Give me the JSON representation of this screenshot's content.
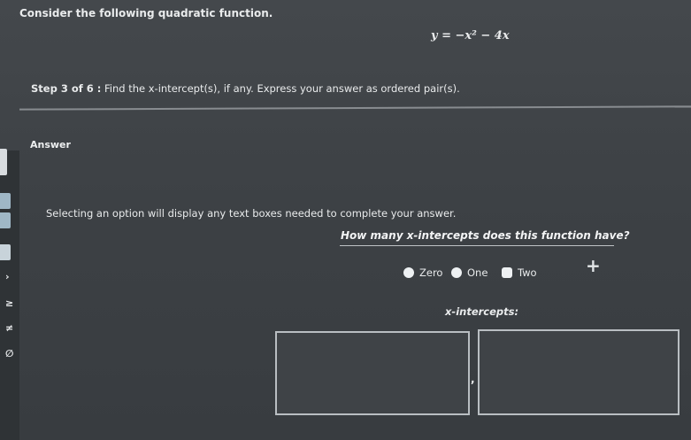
{
  "question": {
    "intro": "Consider the following quadratic function.",
    "equation": "y = −x² − 4x"
  },
  "step": {
    "label": "Step 3 of 6 :",
    "instruction": "Find the x-intercept(s), if any. Express your answer as ordered pair(s)."
  },
  "answer": {
    "heading": "Answer",
    "instruction": "Selecting an option will display any text boxes needed to complete your answer.",
    "prompt": "How many x-intercepts does this function have?",
    "options": [
      {
        "label": "Zero"
      },
      {
        "label": "One"
      },
      {
        "label": "Two"
      }
    ],
    "intercepts_label": "x-intercepts:",
    "separator": ",",
    "add_symbol": "+"
  },
  "toolbar": {
    "glyphs": [
      "›",
      "≥",
      "≠",
      "∅"
    ]
  },
  "colors": {
    "background": "#3b3f43",
    "text": "#e9ebec",
    "tool_strip": "#2f3336",
    "tool_button": "#9fb7c6"
  }
}
